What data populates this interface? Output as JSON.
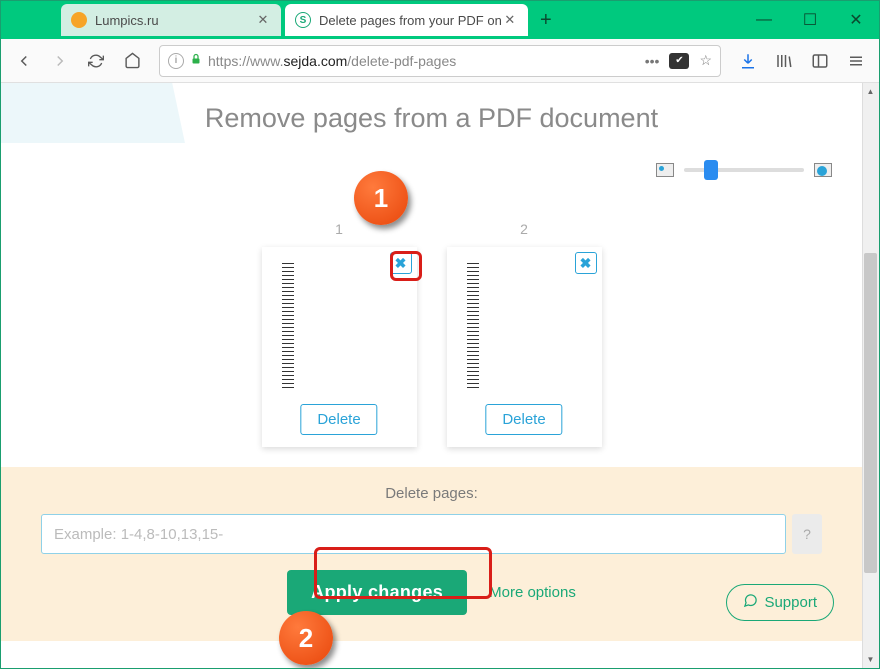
{
  "browser": {
    "tabs": [
      {
        "title": "Lumpics.ru",
        "favicon_color": "#f7a427",
        "active": false
      },
      {
        "title": "Delete pages from your PDF on",
        "favicon_color": "#1aa877",
        "active": true
      }
    ],
    "url_display": "https://www.sejda.com/delete-pdf-pages",
    "url_host_prefix": "https://www.",
    "url_host": "sejda.com",
    "url_path": "/delete-pdf-pages"
  },
  "page": {
    "heading": "Remove pages from a PDF document",
    "thumbnails": [
      {
        "number": "1",
        "delete_label": "Delete"
      },
      {
        "number": "2",
        "delete_label": "Delete"
      }
    ],
    "panel": {
      "label": "Delete pages:",
      "input_placeholder": "Example: 1-4,8-10,13,15-",
      "apply_label": "Apply changes",
      "more_label": "More options",
      "support_label": "Support"
    }
  },
  "callouts": {
    "one": "1",
    "two": "2"
  },
  "colors": {
    "accent": "#1aa877",
    "link_blue": "#2aa3d8",
    "callout": "#ed5012"
  }
}
